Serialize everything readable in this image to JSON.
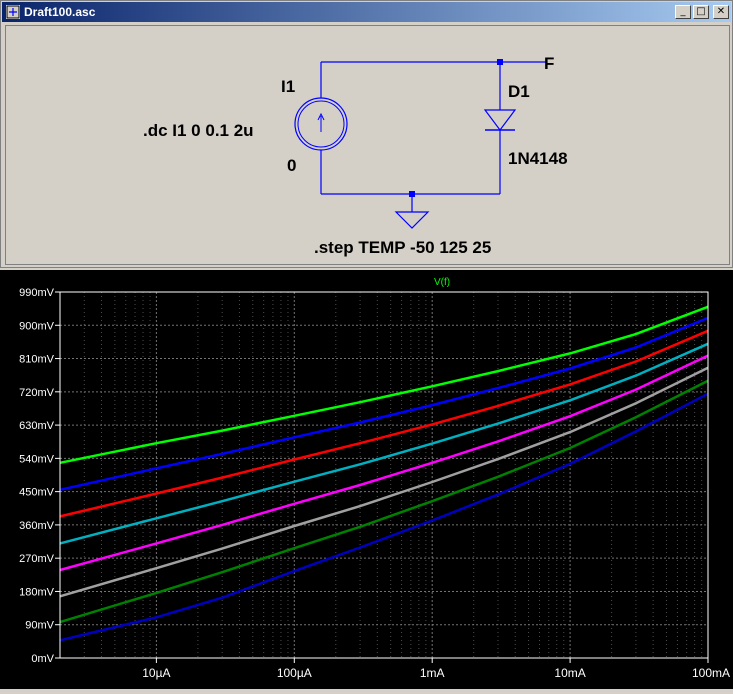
{
  "window": {
    "title": "Draft100.asc",
    "buttons": {
      "minimize": "_",
      "maximize": "□",
      "close": "✕"
    }
  },
  "schematic": {
    "source_name": "I1",
    "source_value": "0",
    "diode_name": "D1",
    "diode_model": "1N4148",
    "net_label": "F",
    "dc_directive": ".dc I1 0 0.1 2u",
    "step_directive": ".step TEMP -50 125 25"
  },
  "colors": {
    "wire": "#0000ff",
    "text": "#000000",
    "grid": "#808080",
    "axis_text": "#ffffff"
  },
  "chart_data": {
    "type": "line",
    "title": "V(f)",
    "title_color": "#00ff00",
    "xlabel": "",
    "ylabel": "",
    "xscale": "log",
    "xlim": [
      2e-06,
      0.1
    ],
    "ylim": [
      0,
      990
    ],
    "grid": true,
    "x_ticks": [
      {
        "value": 1e-05,
        "label": "10µA"
      },
      {
        "value": 0.0001,
        "label": "100µA"
      },
      {
        "value": 0.001,
        "label": "1mA"
      },
      {
        "value": 0.01,
        "label": "10mA"
      },
      {
        "value": 0.1,
        "label": "100mA"
      }
    ],
    "y_ticks": [
      {
        "value": 0,
        "label": "0mV"
      },
      {
        "value": 90,
        "label": "90mV"
      },
      {
        "value": 180,
        "label": "180mV"
      },
      {
        "value": 270,
        "label": "270mV"
      },
      {
        "value": 360,
        "label": "360mV"
      },
      {
        "value": 450,
        "label": "450mV"
      },
      {
        "value": 540,
        "label": "540mV"
      },
      {
        "value": 630,
        "label": "630mV"
      },
      {
        "value": 720,
        "label": "720mV"
      },
      {
        "value": 810,
        "label": "810mV"
      },
      {
        "value": 900,
        "label": "900mV"
      },
      {
        "value": 990,
        "label": "990mV"
      }
    ],
    "x": [
      2e-06,
      1e-05,
      3e-05,
      0.0001,
      0.0003,
      0.001,
      0.003,
      0.01,
      0.03,
      0.1
    ],
    "series": [
      {
        "color": "#00ff00",
        "values": [
          528,
          581,
          615,
          655,
          692,
          735,
          776,
          824,
          876,
          950
        ]
      },
      {
        "color": "#0000ff",
        "values": [
          455,
          513,
          552,
          597,
          637,
          684,
          730,
          783,
          840,
          920
        ]
      },
      {
        "color": "#ff0000",
        "values": [
          383,
          445,
          488,
          537,
          581,
          632,
          682,
          740,
          802,
          885
        ]
      },
      {
        "color": "#00b0c0",
        "values": [
          310,
          378,
          424,
          477,
          524,
          580,
          634,
          697,
          764,
          850
        ]
      },
      {
        "color": "#ff00ff",
        "values": [
          238,
          310,
          360,
          417,
          468,
          528,
          586,
          654,
          726,
          818
        ]
      },
      {
        "color": "#a0a0a0",
        "values": [
          167,
          243,
          296,
          357,
          411,
          476,
          538,
          611,
          689,
          785
        ]
      },
      {
        "color": "#008000",
        "values": [
          97,
          176,
          232,
          297,
          355,
          424,
          490,
          568,
          651,
          750
        ]
      },
      {
        "color": "#0000c0",
        "values": [
          48,
          110,
          163,
          235,
          299,
          372,
          442,
          525,
          613,
          715
        ]
      }
    ]
  }
}
